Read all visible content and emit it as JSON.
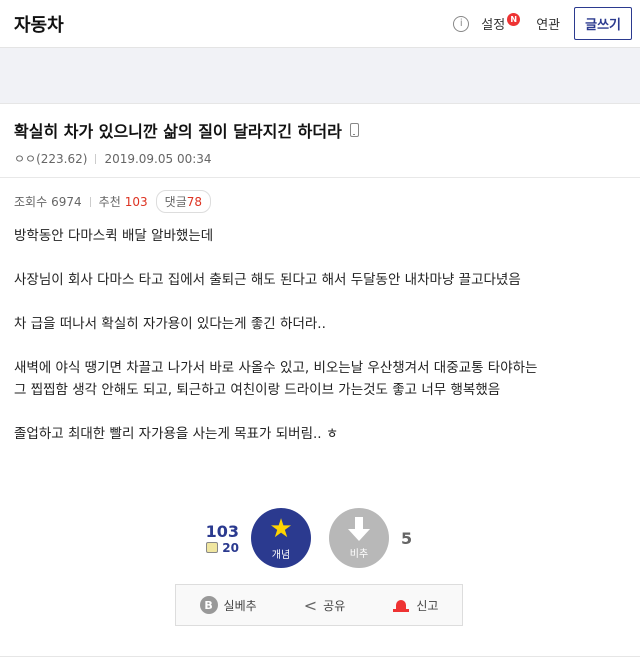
{
  "header": {
    "gallery_title": "자동차",
    "info_icon": "info-icon",
    "setting_label": "설정",
    "new_badge": "N",
    "related_label": "연관",
    "write_label": "글쓰기"
  },
  "post": {
    "title": "확실히 차가 있으니깐 삶의 질이 달라지긴 하더라",
    "author": "ㅇㅇ(223.62)",
    "date": "2019.09.05 00:34",
    "views_label": "조회수",
    "views": "6974",
    "recommend_label": "추천",
    "recommend": "103",
    "comments_label": "댓글",
    "comments": "78",
    "body": [
      "방학동안 다마스퀵 배달 알바했는데",
      "",
      "사장님이 회사 다마스 타고 집에서 출퇴근 해도 된다고 해서 두달동안 내차마냥 끌고다녔음",
      "",
      "차 급을 떠나서 확실히 자가용이 있다는게 좋긴 하더라..",
      "",
      "새벽에 야식 땡기면 차끌고 나가서 바로 사올수 있고, 비오는날 우산챙겨서 대중교통 타야하는",
      "그 찝찝함 생각 안해도 되고, 퇴근하고 여친이랑 드라이브 가는것도 좋고 너무 행복했음",
      "",
      "졸업하고 최대한 빨리 자가용을 사는게 목표가 되버림.. ㅎ"
    ]
  },
  "vote": {
    "recommend": "103",
    "fixed_recommend": "20",
    "up_label": "개념",
    "down_label": "비추",
    "nonrecommend": "5"
  },
  "actions": {
    "best_icon_text": "B",
    "best_label": "실베추",
    "share_label": "공유",
    "report_label": "신고"
  }
}
